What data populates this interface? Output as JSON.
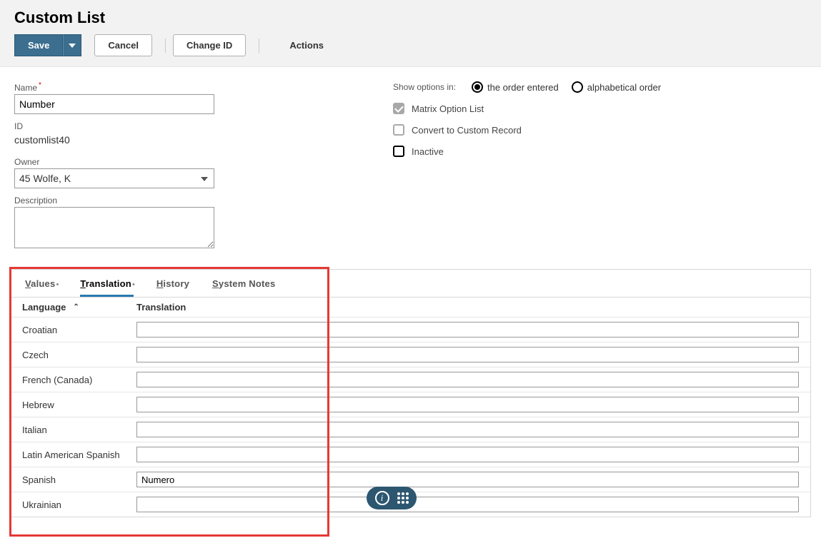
{
  "page": {
    "title": "Custom List"
  },
  "toolbar": {
    "save": "Save",
    "cancel": "Cancel",
    "change_id": "Change ID",
    "actions": "Actions"
  },
  "fields": {
    "name_label": "Name",
    "name_value": "Number",
    "id_label": "ID",
    "id_value": "customlist40",
    "owner_label": "Owner",
    "owner_value": "45 Wolfe, K",
    "description_label": "Description",
    "description_value": ""
  },
  "options": {
    "show_options_label": "Show options in:",
    "order_entered": "the order entered",
    "alphabetical": "alphabetical order",
    "order_selected": "entered",
    "matrix_label": "Matrix Option List",
    "matrix_checked": true,
    "convert_label": "Convert to Custom Record",
    "convert_checked": false,
    "inactive_label": "Inactive",
    "inactive_checked": false
  },
  "tabs": {
    "values": "Values",
    "translation": "Translation",
    "history": "History",
    "system_notes": "System Notes",
    "active": "translation"
  },
  "translation_table": {
    "col_language": "Language",
    "col_translation": "Translation",
    "rows": [
      {
        "language": "Croatian",
        "translation": ""
      },
      {
        "language": "Czech",
        "translation": ""
      },
      {
        "language": "French (Canada)",
        "translation": ""
      },
      {
        "language": "Hebrew",
        "translation": ""
      },
      {
        "language": "Italian",
        "translation": ""
      },
      {
        "language": "Latin American Spanish",
        "translation": ""
      },
      {
        "language": "Spanish",
        "translation": "Numero"
      },
      {
        "language": "Ukrainian",
        "translation": ""
      }
    ]
  }
}
